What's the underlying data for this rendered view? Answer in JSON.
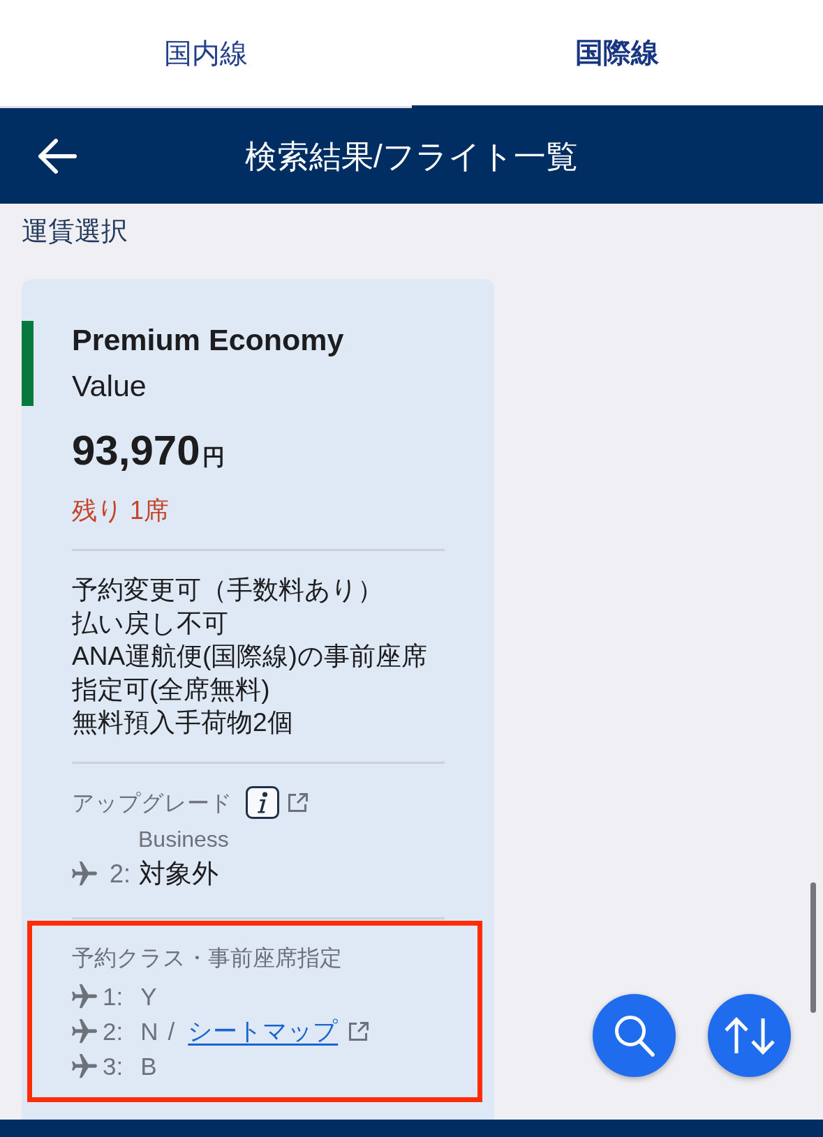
{
  "tabs": [
    {
      "label": "国内線",
      "selected": false
    },
    {
      "label": "国際線",
      "selected": true
    }
  ],
  "header": {
    "title": "検索結果/フライト一覧"
  },
  "section_title": "運賃選択",
  "fares": [
    {
      "color": "#067a3e",
      "class_name": "Premium Economy",
      "fare_type": "Value",
      "price": "93,970",
      "currency": "円",
      "seats_left": "残り 1席",
      "conditions": [
        "予約変更可（手数料あり）",
        "払い戻し不可",
        "ANA運航便(国際線)の事前座席指定可(全席無料)",
        "無料預入手荷物2個"
      ],
      "upgrade": {
        "label": "アップグレード",
        "cabin": "Business",
        "segments": [
          {
            "number": "2:",
            "status": "対象外"
          }
        ]
      },
      "booking": {
        "label": "予約クラス・事前座席指定",
        "highlighted": true,
        "segments": [
          {
            "number": "1:",
            "class": "Y"
          },
          {
            "number": "2:",
            "class": "N",
            "separator": "/",
            "link": "シートマップ"
          },
          {
            "number": "3:",
            "class": "B"
          }
        ]
      }
    }
  ]
}
